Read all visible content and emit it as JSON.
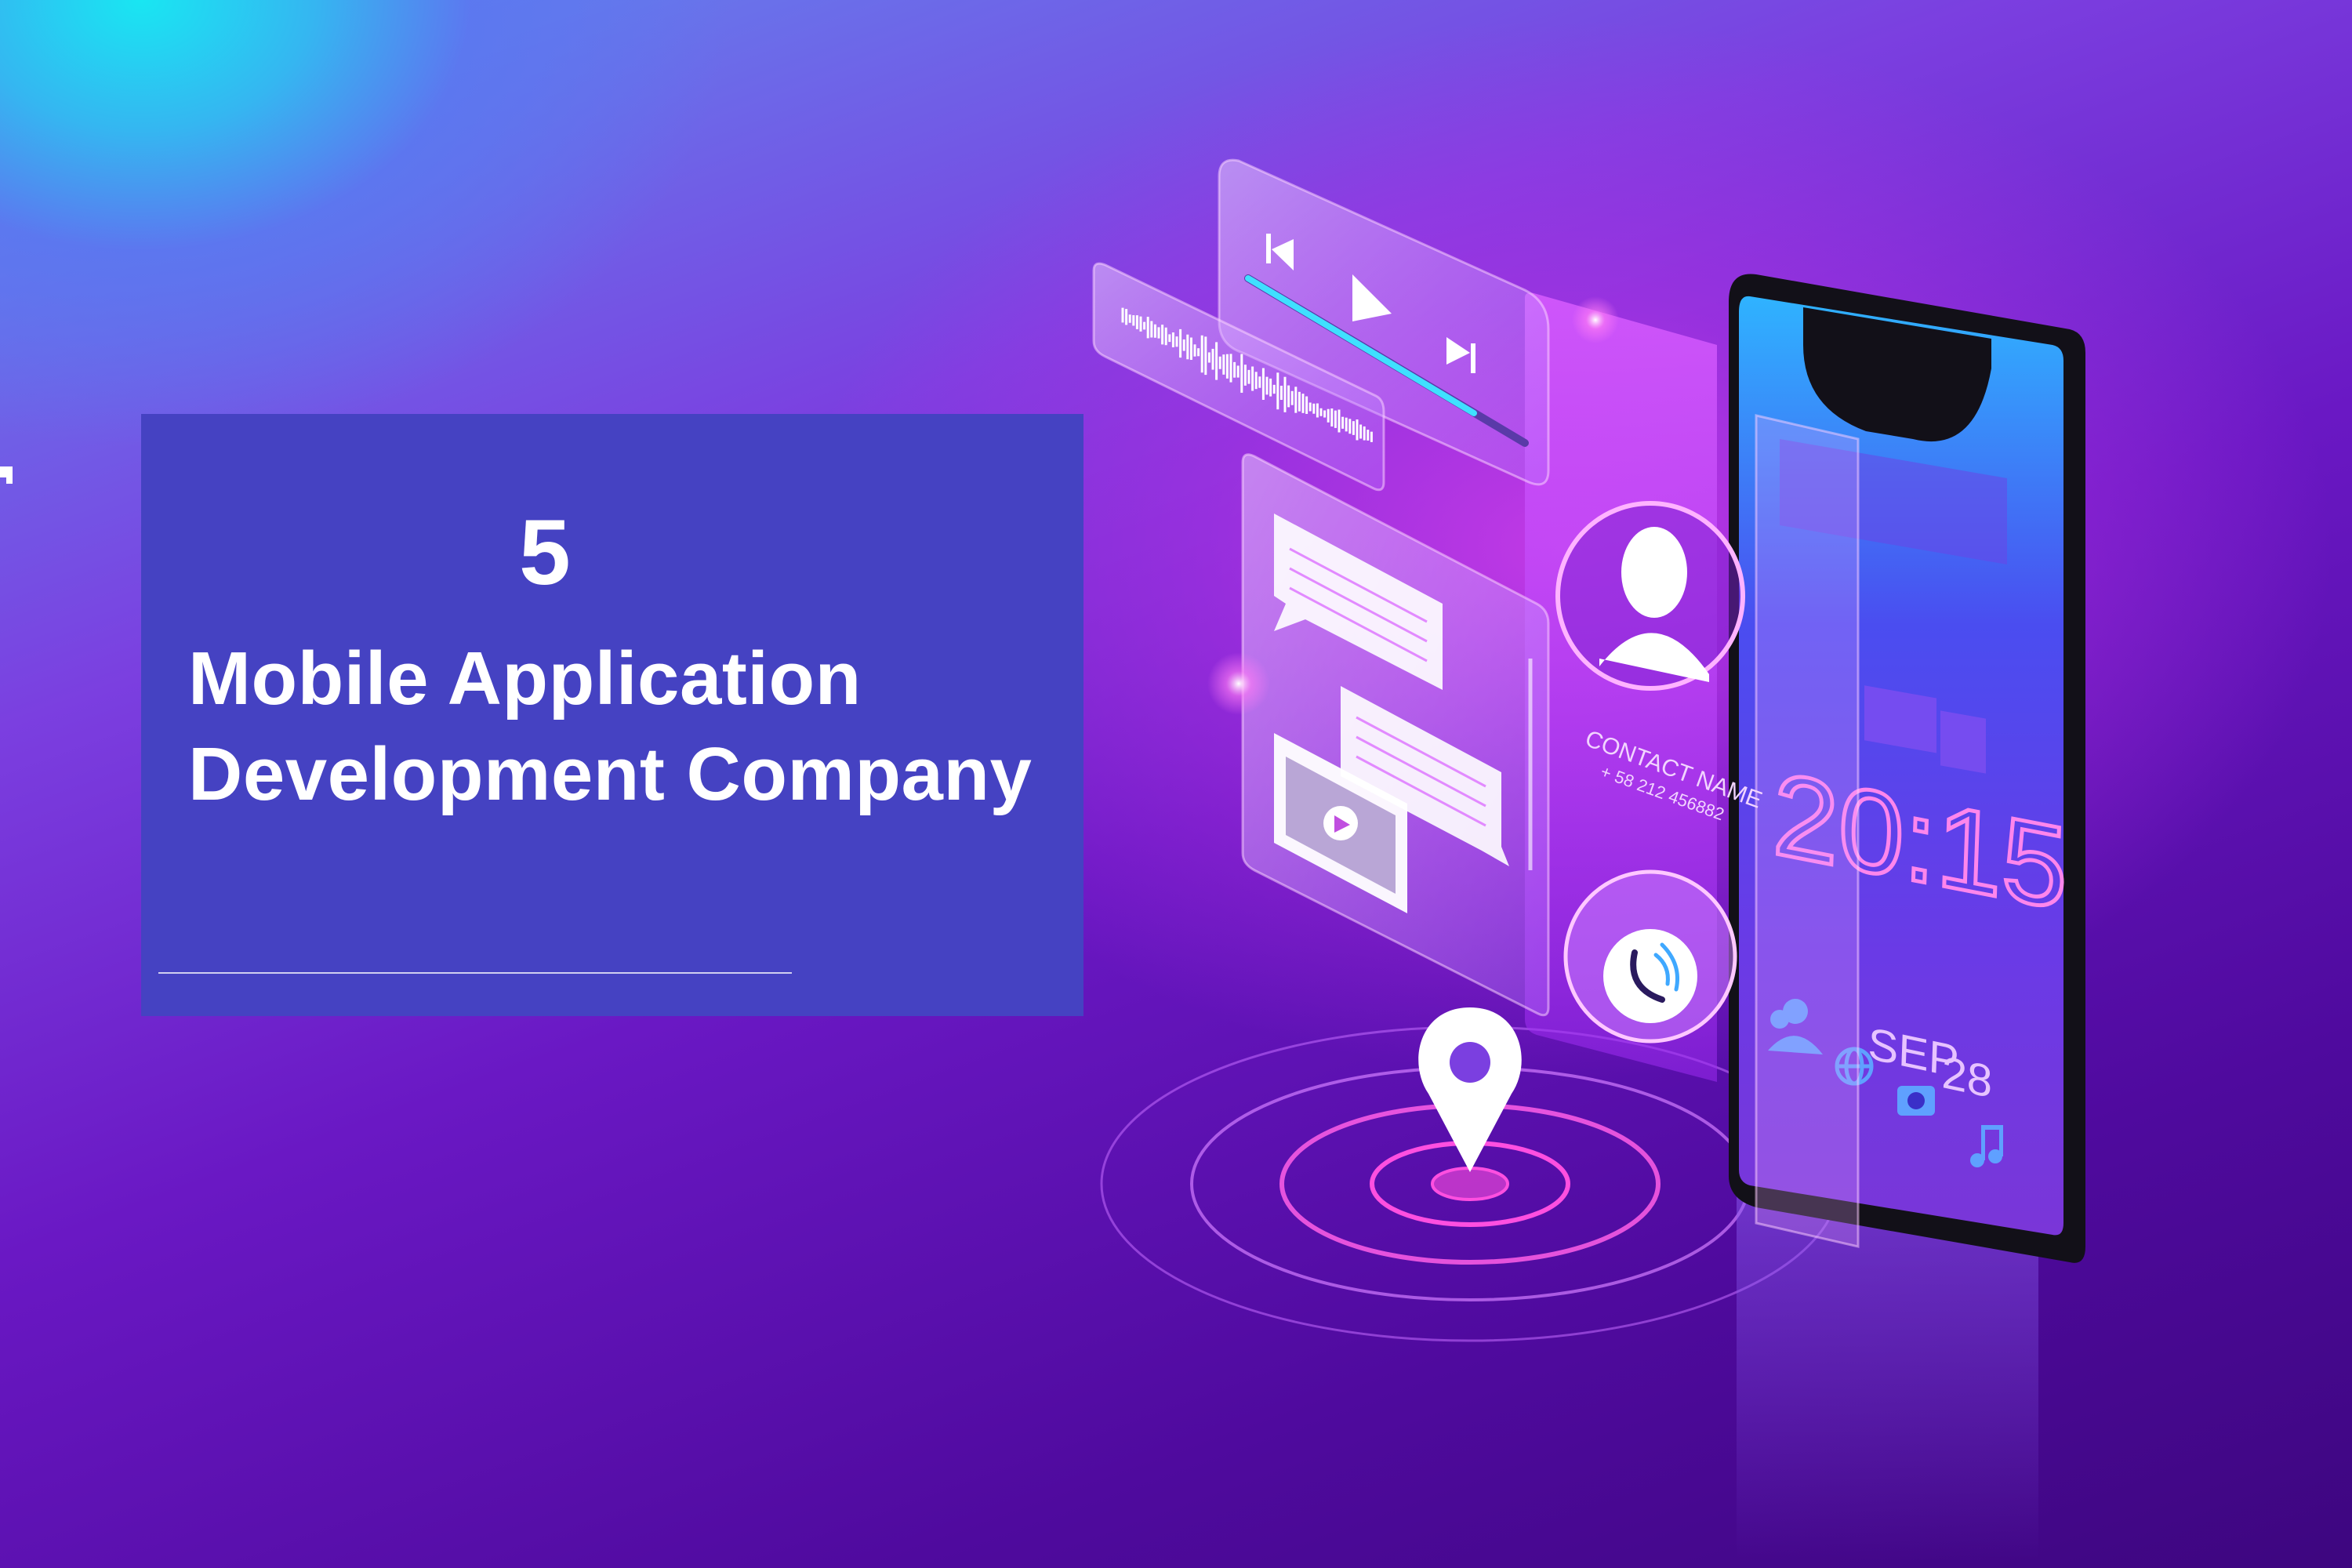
{
  "hero": {
    "number": "5",
    "title_line1": "Mobile Application",
    "title_line2": "Development Company",
    "card_color": "#4542c2"
  },
  "phone_screen": {
    "time": "20:15",
    "month": "SEP",
    "day": "28"
  },
  "contact_card": {
    "name": "CONTACT NAME",
    "phone": "+ 58 212 456882"
  },
  "icons": [
    "previous-track-icon",
    "play-icon",
    "next-track-icon",
    "sound-wave-icon",
    "chat-bubble-icon",
    "video-play-icon",
    "avatar-icon",
    "phone-call-icon",
    "location-pin-icon",
    "contacts-icon",
    "globe-icon",
    "camera-icon",
    "music-note-icon"
  ],
  "colors": {
    "accent_pink": "#ff4fe0",
    "accent_cyan": "#3fe0ff",
    "background_dark": "#4f0a9e"
  }
}
